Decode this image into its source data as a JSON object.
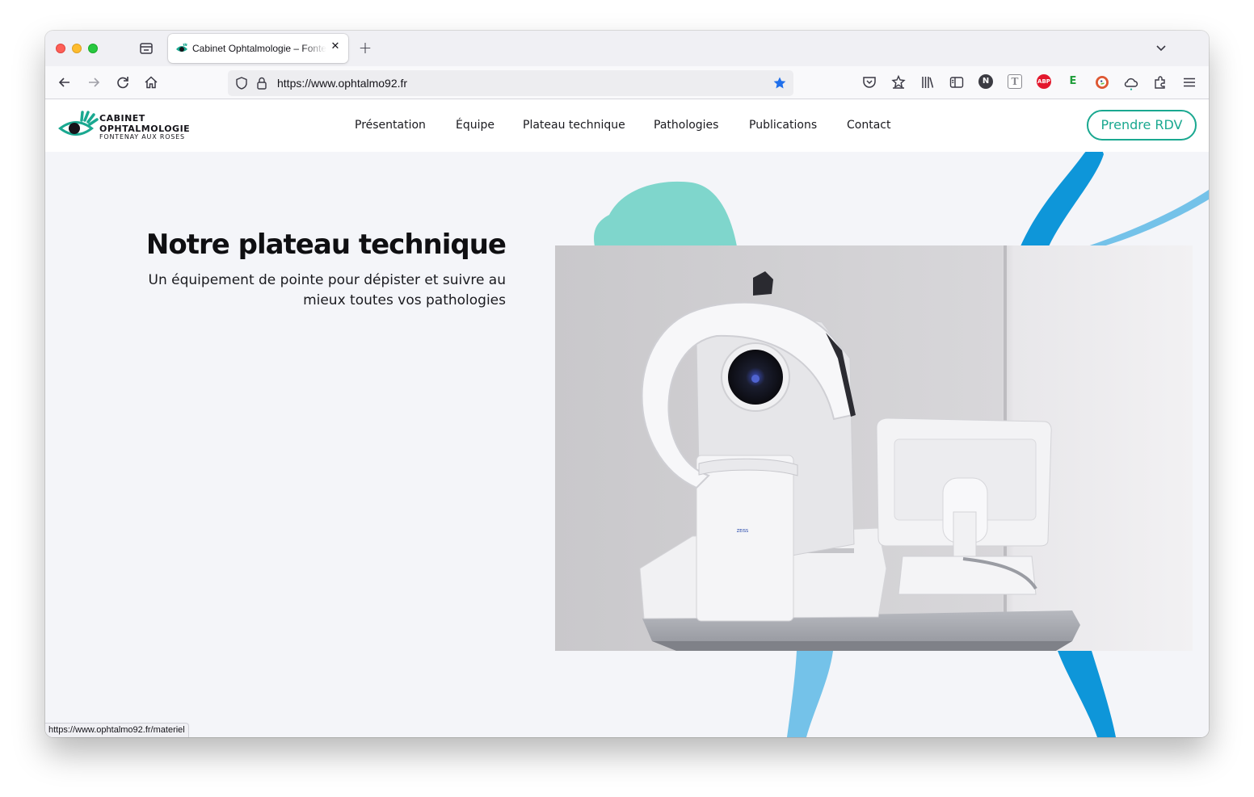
{
  "browser": {
    "tab_title": "Cabinet Ophtalmologie – Fontenay aux Roses",
    "url": "https://www.ophtalmo92.fr",
    "status_url": "https://www.ophtalmo92.fr/materiel",
    "icons": [
      "tab-list-icon",
      "new-tab-icon",
      "back-icon",
      "forward-icon",
      "reload-icon",
      "home-icon",
      "shield-icon",
      "lock-icon",
      "bookmark-star-icon",
      "pocket-icon",
      "extensions-puzzle-icon",
      "library-icon",
      "sidebar-icon",
      "menu-icon"
    ],
    "extensions": [
      {
        "name": "n-extension-icon",
        "label": "N",
        "color": "#3b3b42"
      },
      {
        "name": "t-extension-icon",
        "label": "T",
        "color": "#8a8a90"
      },
      {
        "name": "adblock-plus-icon",
        "label": "ABP",
        "color": "#e3182d"
      },
      {
        "name": "e-extension-icon",
        "label": "E",
        "color": "#1f9d3a"
      },
      {
        "name": "duckduckgo-icon",
        "label": "",
        "color": "#de5833"
      }
    ],
    "accent": "#1f6feb"
  },
  "site": {
    "logo": {
      "line1": "CABINET",
      "line2": "OPHTALMOLOGIE",
      "line3": "FONTENAY AUX ROSES"
    },
    "nav": [
      {
        "label": "Présentation"
      },
      {
        "label": "Équipe"
      },
      {
        "label": "Plateau technique"
      },
      {
        "label": "Pathologies"
      },
      {
        "label": "Publications"
      },
      {
        "label": "Contact"
      }
    ],
    "cta_label": "Prendre RDV",
    "colors": {
      "brand_teal": "#1aa890",
      "mint_shape": "#7fd6cc",
      "blue_shape": "#0e96d9",
      "light_blue_shape": "#74c2e9"
    }
  },
  "hero": {
    "title": "Notre plateau technique",
    "subtitle": "Un équipement de pointe pour dépister et suivre au mieux toutes vos pathologies",
    "image_alt": "Zeiss IOLMaster 700 ophthalmic biometry device next to a monitor"
  }
}
